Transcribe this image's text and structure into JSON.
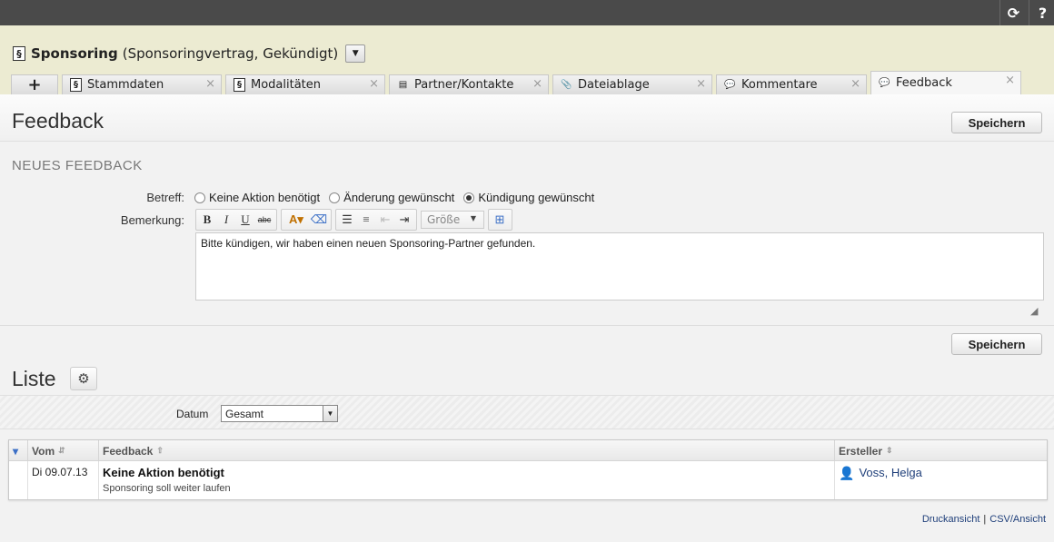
{
  "topbar": {
    "sync_icon": "sync-icon",
    "help_label": "?"
  },
  "header": {
    "title": "Sponsoring",
    "subtitle": "(Sponsoringvertrag, Gekündigt)",
    "para_symbol": "§"
  },
  "tabs": [
    {
      "label": "Stammdaten",
      "icon": "§"
    },
    {
      "label": "Modalitäten",
      "icon": "§"
    },
    {
      "label": "Partner/Kontakte",
      "icon": "▤"
    },
    {
      "label": "Dateiablage",
      "icon": "📎"
    },
    {
      "label": "Kommentare",
      "icon": "💬"
    },
    {
      "label": "Feedback",
      "icon": "💬"
    }
  ],
  "add_tab_label": "+",
  "close_glyph": "×",
  "form": {
    "heading": "Feedback",
    "save_label": "Speichern",
    "subheading": "NEUES FEEDBACK",
    "betreff_label": "Betreff:",
    "bemerkung_label": "Bemerkung:",
    "options": [
      "Keine Aktion benötigt",
      "Änderung gewünscht",
      "Kündigung gewünscht"
    ],
    "selected_option": "Kündigung gewünscht",
    "size_placeholder": "Größe",
    "text_value": "Bitte kündigen, wir haben einen neuen Sponsoring-Partner gefunden."
  },
  "list": {
    "heading": "Liste",
    "filter_label": "Datum",
    "filter_value": "Gesamt",
    "columns": {
      "vom": "Vom",
      "feedback": "Feedback",
      "ersteller": "Ersteller"
    },
    "rows": [
      {
        "vom": "Di 09.07.13",
        "feedback_title": "Keine Aktion benötigt",
        "feedback_text": "Sponsoring soll weiter laufen",
        "ersteller": "Voss, Helga"
      }
    ]
  },
  "footer": {
    "print_label": "Druckansicht",
    "csv_label": "CSV/Ansicht"
  }
}
